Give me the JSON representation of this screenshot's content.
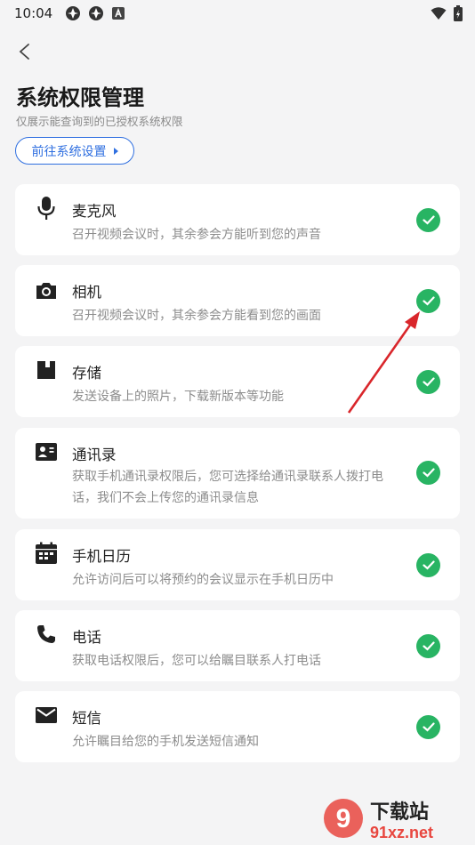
{
  "status": {
    "time": "10:04"
  },
  "header": {
    "title": "系统权限管理",
    "subtitle": "仅展示能查询到的已授权系统权限",
    "settings_button": "前往系统设置"
  },
  "permissions": [
    {
      "title": "麦克风",
      "desc": "召开视频会议时，其余参会方能听到您的声音",
      "icon": "microphone-icon"
    },
    {
      "title": "相机",
      "desc": "召开视频会议时，其余参会方能看到您的画面",
      "icon": "camera-icon"
    },
    {
      "title": "存储",
      "desc": "发送设备上的照片，下载新版本等功能",
      "icon": "storage-icon"
    },
    {
      "title": "通讯录",
      "desc": "获取手机通讯录权限后，您可选择给通讯录联系人拨打电话，我们不会上传您的通讯录信息",
      "icon": "contacts-icon"
    },
    {
      "title": "手机日历",
      "desc": "允许访问后可以将预约的会议显示在手机日历中",
      "icon": "calendar-icon"
    },
    {
      "title": "电话",
      "desc": "获取电话权限后，您可以给瞩目联系人打电话",
      "icon": "phone-icon"
    },
    {
      "title": "短信",
      "desc": "允许瞩目给您的手机发送短信通知",
      "icon": "sms-icon"
    }
  ],
  "watermark": {
    "logo": "9",
    "brand": "下载站",
    "site": "91xz.net"
  },
  "colors": {
    "accent": "#2f6fe0",
    "check": "#28b463",
    "arrow": "#d9262b"
  }
}
